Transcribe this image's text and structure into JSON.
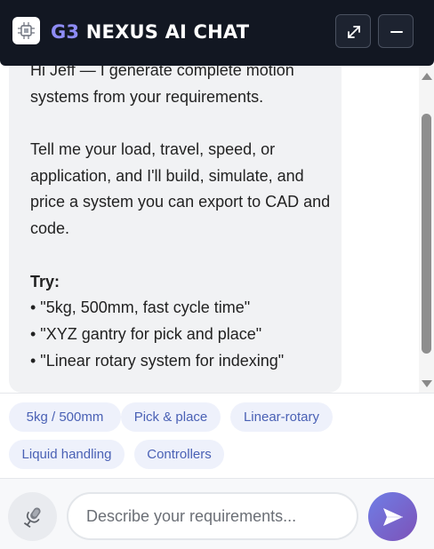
{
  "header": {
    "title_prefix": "G3",
    "title_rest": "NEXUS AI CHAT",
    "logo_icon": "circuit-chip-icon",
    "expand_icon": "expand-icon",
    "minimize_icon": "minimize-icon"
  },
  "message": {
    "paragraph1": "Hi Jeff — I generate complete motion systems from your requirements.",
    "paragraph2": "Tell me your load, travel, speed, or application, and I'll build, simulate, and price a system you can export to CAD and code.",
    "try_label": "Try:",
    "examples": [
      "• \"5kg, 500mm, fast cycle time\"",
      "• \"XYZ gantry for pick and place\"",
      "• \"Linear rotary system for indexing\""
    ]
  },
  "suggestions": [
    "5kg / 500mm",
    "Pick & place",
    "Linear-rotary",
    "Liquid handling",
    "Controllers"
  ],
  "composer": {
    "placeholder": "Describe your requirements...",
    "value": "",
    "mic_icon": "microphone-icon",
    "send_icon": "send-icon"
  },
  "colors": {
    "header_bg": "#121722",
    "accent": "#8e8cf5",
    "chip_bg": "#eef1fb",
    "chip_text": "#4a61b5",
    "send_gradient_start": "#6f7ee6",
    "send_gradient_end": "#7d52b8"
  }
}
